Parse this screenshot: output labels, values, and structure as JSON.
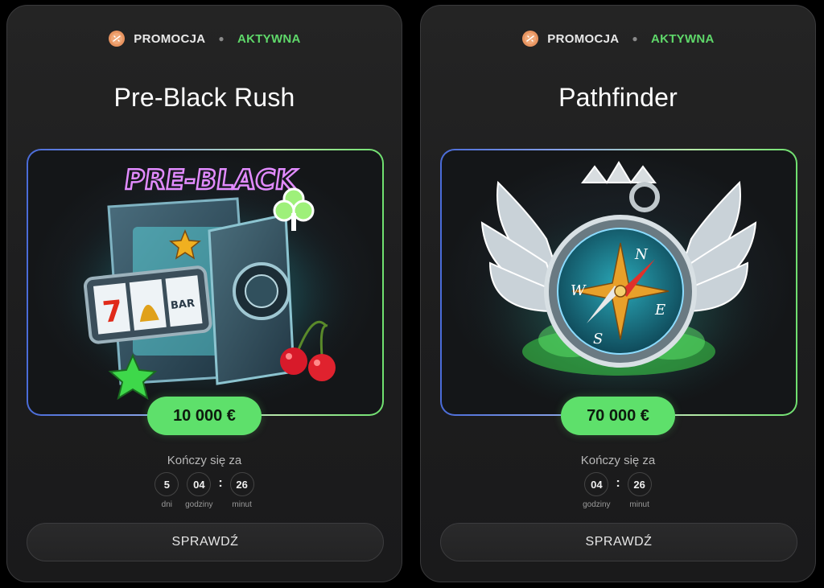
{
  "promotions": [
    {
      "badge_label": "PROMOCJA",
      "status": "AKTYWNA",
      "title": "Pre-Black Rush",
      "art_text": "PRE-BLACK",
      "reel_text": "BAR",
      "prize": "10 000 €",
      "ends_label": "Kończy się za",
      "timer": {
        "days": "5",
        "days_label": "dni",
        "hours": "04",
        "hours_label": "godziny",
        "minutes": "26",
        "minutes_label": "minut"
      },
      "button_label": "SPRAWDŹ"
    },
    {
      "badge_label": "PROMOCJA",
      "status": "AKTYWNA",
      "title": "Pathfinder",
      "compass": {
        "n": "N",
        "e": "E",
        "s": "S",
        "w": "W"
      },
      "prize": "70 000 €",
      "ends_label": "Kończy się za",
      "timer": {
        "hours": "04",
        "hours_label": "godziny",
        "minutes": "26",
        "minutes_label": "minut"
      },
      "button_label": "SPRAWDŹ"
    }
  ],
  "colors": {
    "accent_green": "#5ee06b",
    "status_green": "#5fd86a",
    "card_bg": "#1f1f20",
    "frame_blue": "#4a6bd8"
  }
}
